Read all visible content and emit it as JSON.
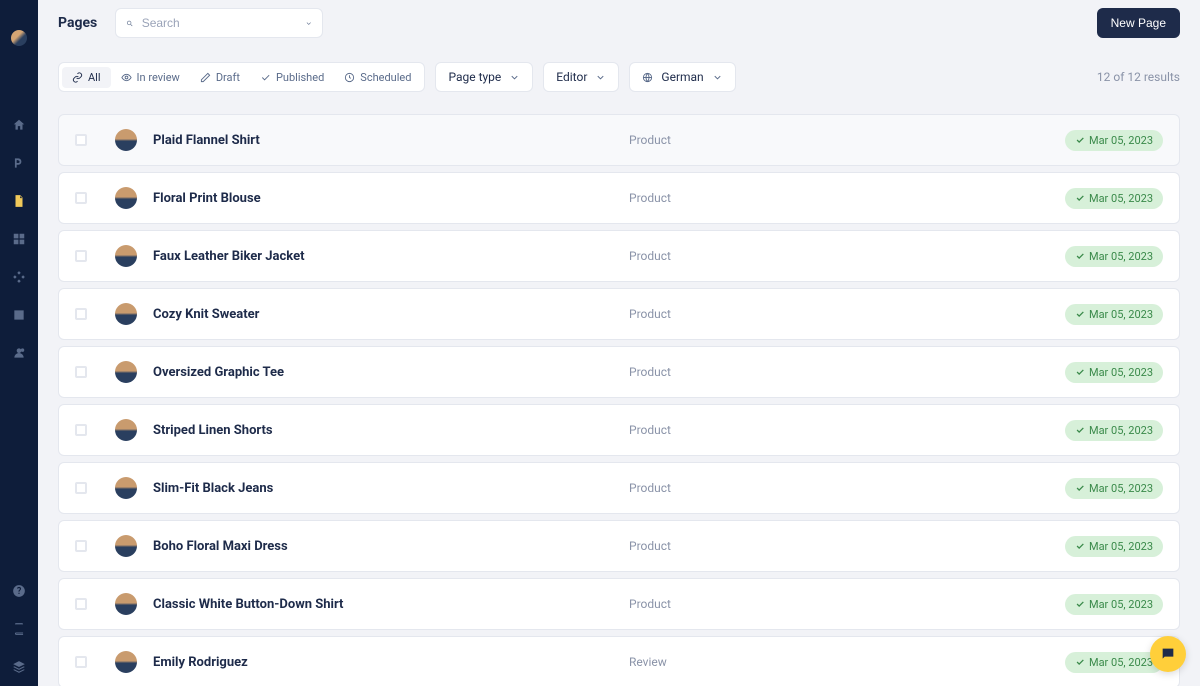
{
  "header": {
    "title": "Pages",
    "search_placeholder": "Search",
    "new_page_label": "New Page"
  },
  "filters": {
    "all": "All",
    "in_review": "In review",
    "draft": "Draft",
    "published": "Published",
    "scheduled": "Scheduled",
    "page_type": "Page type",
    "editor": "Editor",
    "language": "German"
  },
  "results_text": "12 of 12 results",
  "items": [
    {
      "title": "Plaid Flannel Shirt",
      "type": "Product",
      "status_date": "Mar 05, 2023"
    },
    {
      "title": "Floral Print Blouse",
      "type": "Product",
      "status_date": "Mar 05, 2023"
    },
    {
      "title": "Faux Leather Biker Jacket",
      "type": "Product",
      "status_date": "Mar 05, 2023"
    },
    {
      "title": "Cozy Knit Sweater",
      "type": "Product",
      "status_date": "Mar 05, 2023"
    },
    {
      "title": "Oversized Graphic Tee",
      "type": "Product",
      "status_date": "Mar 05, 2023"
    },
    {
      "title": "Striped Linen Shorts",
      "type": "Product",
      "status_date": "Mar 05, 2023"
    },
    {
      "title": "Slim-Fit Black Jeans",
      "type": "Product",
      "status_date": "Mar 05, 2023"
    },
    {
      "title": "Boho Floral Maxi Dress",
      "type": "Product",
      "status_date": "Mar 05, 2023"
    },
    {
      "title": "Classic White Button-Down Shirt",
      "type": "Product",
      "status_date": "Mar 05, 2023"
    },
    {
      "title": "Emily Rodriguez",
      "type": "Review",
      "status_date": "Mar 05, 2023"
    }
  ]
}
